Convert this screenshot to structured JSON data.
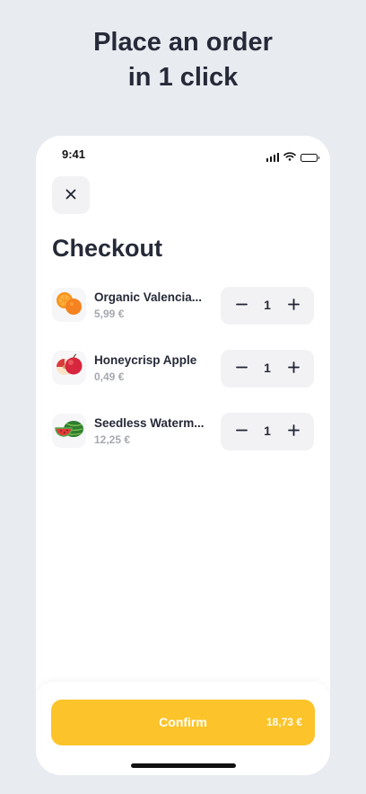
{
  "headline": {
    "line1": "Place an order",
    "line2": "in 1 click"
  },
  "status_bar": {
    "time": "9:41",
    "icons": [
      "signal-icon",
      "wifi-icon",
      "battery-icon"
    ]
  },
  "close_button": {
    "icon": "close-icon"
  },
  "title": "Checkout",
  "items": [
    {
      "name": "Organic Valencia...",
      "price": "5,99 €",
      "quantity": "1",
      "icon": "orange-icon"
    },
    {
      "name": "Honeycrisp Apple",
      "price": "0,49 €",
      "quantity": "1",
      "icon": "apple-icon"
    },
    {
      "name": "Seedless Waterm...",
      "price": "12,25 €",
      "quantity": "1",
      "icon": "watermelon-icon"
    }
  ],
  "stepper": {
    "minus_icon": "minus-icon",
    "plus_icon": "plus-icon"
  },
  "confirm": {
    "label": "Confirm",
    "total": "18,73 €"
  },
  "colors": {
    "accent": "#fcc42a",
    "background": "#e8ebf0",
    "text": "#262a38",
    "muted": "#a6a8b0"
  }
}
